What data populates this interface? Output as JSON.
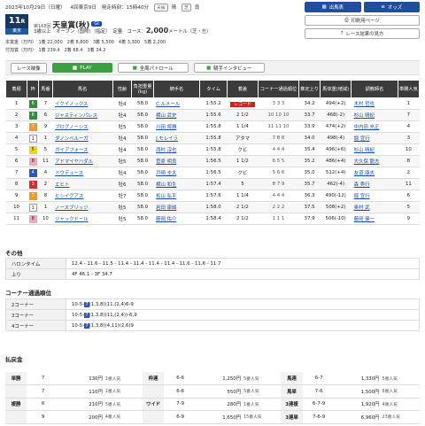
{
  "header": {
    "date": "2023年10月29日（日曜）",
    "meeting": "4回東京9日",
    "post_time": "発走時刻：15時40分",
    "weather": [
      "天候",
      "晴",
      "芝",
      "良"
    ]
  },
  "race": {
    "number": "11",
    "unit": "R",
    "badge": "東京",
    "edition": "第168回",
    "name": "天皇賞(秋)",
    "grade": "GI",
    "conditions": "3歳以上　オープン（国際）（指定）　定量",
    "course": "コース：",
    "distance": "2,000",
    "distance_unit": "メートル（芝・左）"
  },
  "prize": {
    "line1": "本賞金（万円）　1着 22,000　2着 8,800　3着 5,500　4着 3,300　5着 2,200",
    "line2": "付加賞（万円）　1着 239.4　2着 68.4　3着 34.2"
  },
  "buttons": {
    "results": "出馬表",
    "odds": "オッズ",
    "print": "印刷用ページ",
    "race_list": "レース結果の見方"
  },
  "media": {
    "video_label": "レース映像",
    "play": "PLAY",
    "patrol": "全周パトロール",
    "interview": "騎手インタビュー"
  },
  "columns": [
    "着順",
    "枠",
    "馬番",
    "馬名",
    "性齢",
    "負担重量(kg)",
    "騎手名",
    "タイム",
    "着差",
    "コーナー通過順位",
    "推定上り",
    "馬体重(増減)",
    "調教師名",
    "単勝人気"
  ],
  "rows": [
    [
      "1",
      "6",
      "7",
      "イクイノックス",
      "牡4",
      "58.0",
      "C.ルメール",
      "1:55.2",
      "レコード",
      "3 3 3",
      "34.2",
      "494(+2)",
      "木村 哲也",
      "1"
    ],
    [
      "2",
      "6",
      "6",
      "ジャスティンパレス",
      "牡4",
      "58.0",
      "横山 武史",
      "1:55.6",
      "2 1/2",
      "10 10 10",
      "33.7",
      "468(-2)",
      "杉山 晴紀",
      "7"
    ],
    [
      "3",
      "7",
      "9",
      "プログノーシス",
      "牡5",
      "58.0",
      "川田 将雅",
      "1:55.8",
      "1 1/4",
      "11 11 10",
      "33.9",
      "474(+2)",
      "中内田 充正",
      "4"
    ],
    [
      "4",
      "1",
      "1",
      "ダノンベルーガ",
      "牡4",
      "58.0",
      "J.モレイラ",
      "1:55.8",
      "アタマ",
      "7 8 8",
      "34.0",
      "498(-4)",
      "堀 宣行",
      "3"
    ],
    [
      "5",
      "5",
      "5",
      "ガイアフォース",
      "牡4",
      "58.0",
      "西村 淳也",
      "1:55.8",
      "クビ",
      "4 4 4",
      "35.4",
      "496(+6)",
      "杉山 晴紀",
      "10"
    ],
    [
      "6",
      "8",
      "11",
      "アドマイヤハダル",
      "牡5",
      "58.0",
      "菅原 明良",
      "1:56.5",
      "1 1/2",
      "6 5 5",
      "35.2",
      "486(+4)",
      "大久保 龍志",
      "8"
    ],
    [
      "7",
      "4",
      "4",
      "ドウデュース",
      "牡4",
      "58.0",
      "戸崎 圭太",
      "1:56.5",
      "クビ",
      "5 6 6",
      "35.0",
      "512(+4)",
      "友道 康夫",
      "2"
    ],
    [
      "8",
      "3",
      "2",
      "エヒト",
      "牡6",
      "58.0",
      "横山 和生",
      "1:57.4",
      "5",
      "8 7 9",
      "35.7",
      "462(-4)",
      "森 秀行",
      "11"
    ],
    [
      "9",
      "7",
      "8",
      "ヒシイグアス",
      "牡7",
      "58.0",
      "松山 弘平",
      "1:57.6",
      "1 1/4",
      "4 4 4",
      "36.3",
      "490(-12)",
      "堀 宣行",
      "6"
    ],
    [
      "10",
      "1",
      "1",
      "ノースブリッジ",
      "牡5",
      "58.0",
      "岩田 康誠",
      "1:58.0",
      "2 1/2",
      "2 2 2",
      "37.5",
      "508(+2)",
      "奥村 武",
      "5"
    ],
    [
      "11",
      "8",
      "10",
      "ジャックドール",
      "牡5",
      "58.0",
      "藤岡 佑介",
      "1:58.4",
      "2 1/2",
      "1 1 1",
      "37.9",
      "506(-10)",
      "藤岡 健一",
      "9"
    ]
  ],
  "extra": {
    "section": "その他",
    "rows": [
      {
        "k": "ハロンタイム",
        "v": "12.4 - 11.6 - 11.5 - 11.4 - 11.4 - 11.4 - 11.4 - 11.6 - 11.6 - 11.7"
      },
      {
        "k": "上り",
        "v": "4F 46.1 - 3F 34.7"
      }
    ]
  },
  "corners": {
    "section": "コーナー通過順位",
    "rows": [
      {
        "k": "2コーナー",
        "v": "10-5-",
        "hl": "7",
        "rest": "(1,3,8)(11,(2,4)6-9"
      },
      {
        "k": "3コーナー",
        "v": "10-5-",
        "hl": "7",
        "rest": "(1,3,8)(11,(2,4))-6,9"
      },
      {
        "k": "4コーナー",
        "v": "10-5-",
        "hl": "7",
        "rest": "(1,3,8)(4,11)(2,6)9"
      }
    ]
  },
  "payouts": {
    "section": "払戻金",
    "rows": [
      [
        "単勝",
        "7",
        "130円",
        "1番人気",
        "枠連",
        "6-6",
        "1,250円",
        "5番人気",
        "馬連",
        "6-7",
        "1,330円",
        "5番人気"
      ],
      [
        "",
        "7",
        "110円",
        "1番人気",
        "",
        "6-6",
        "550円",
        "5番人気",
        "馬単",
        "7-6",
        "1,500円",
        "6番人気"
      ],
      [
        "複勝",
        "6",
        "210円",
        "5番人気",
        "ワイド",
        "7-9",
        "280円",
        "1番人気",
        "3連複",
        "6-7-9",
        "1,920円",
        "4番人気"
      ],
      [
        "",
        "9",
        "200円",
        "4番人気",
        "",
        "6-9",
        "1,650円",
        "15番人気",
        "3連単",
        "7-6-9",
        "6,960円",
        "23番人気"
      ]
    ]
  }
}
